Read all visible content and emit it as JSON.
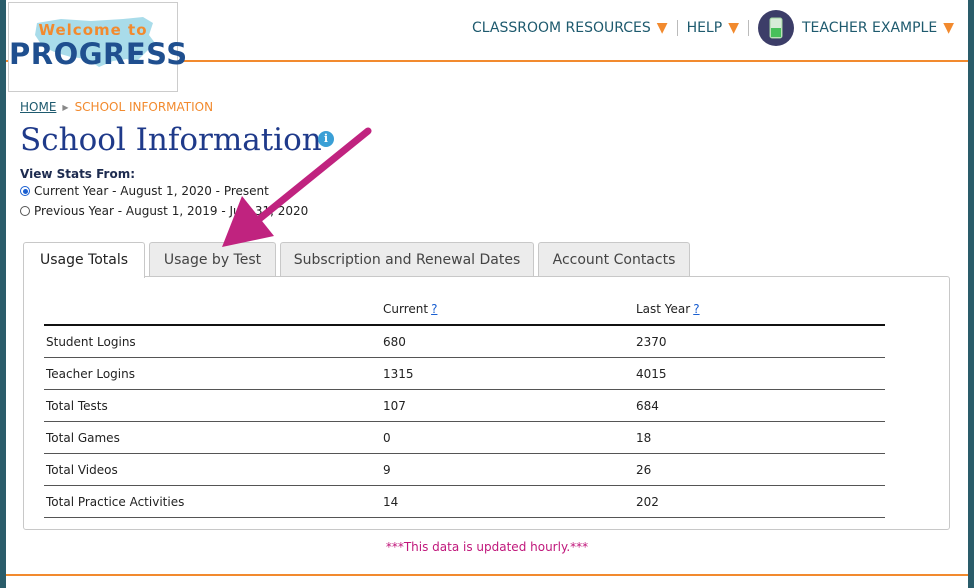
{
  "logo": {
    "top": "Welcome to",
    "main": "PROGRESS"
  },
  "nav": {
    "classroom_resources": "CLASSROOM RESOURCES",
    "help": "HELP",
    "user": "TEACHER EXAMPLE",
    "dropdown_glyph": "▼"
  },
  "breadcrumb": {
    "home": "HOME",
    "current": "SCHOOL INFORMATION"
  },
  "page_title": "School Information",
  "info_glyph": "i",
  "view_stats": {
    "label": "View Stats From:",
    "options": [
      {
        "label": "Current Year - August 1, 2020 - Present",
        "selected": true
      },
      {
        "label": "Previous Year - August 1, 2019 - July 31, 2020",
        "selected": false
      }
    ]
  },
  "tabs": [
    {
      "label": "Usage Totals",
      "active": true
    },
    {
      "label": "Usage by Test",
      "active": false
    },
    {
      "label": "Subscription and Renewal Dates",
      "active": false
    },
    {
      "label": "Account Contacts",
      "active": false
    }
  ],
  "table": {
    "headers": [
      "",
      "Current",
      "Last Year"
    ],
    "help_glyph": "?",
    "rows": [
      {
        "label": "Student Logins",
        "current": "680",
        "last_year": "2370"
      },
      {
        "label": "Teacher Logins",
        "current": "1315",
        "last_year": "4015"
      },
      {
        "label": "Total Tests",
        "current": "107",
        "last_year": "684"
      },
      {
        "label": "Total Games",
        "current": "0",
        "last_year": "18"
      },
      {
        "label": "Total Videos",
        "current": "9",
        "last_year": "26"
      },
      {
        "label": "Total Practice Activities",
        "current": "14",
        "last_year": "202"
      }
    ]
  },
  "note": "***This data is updated hourly.***",
  "colors": {
    "accent_orange": "#f28a2e",
    "title_blue": "#1f3a8a",
    "note_magenta": "#c0177b",
    "arrow_magenta": "#c0237f"
  }
}
